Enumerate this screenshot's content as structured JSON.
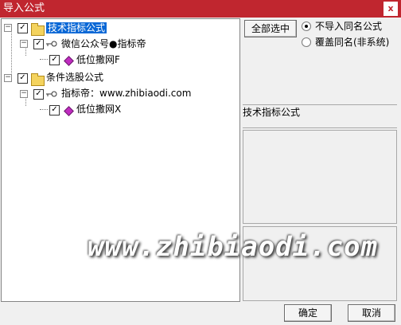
{
  "window": {
    "title": "导入公式",
    "close": "x"
  },
  "tree": {
    "group1": {
      "label": "技术指标公式",
      "checked": true,
      "child": {
        "label": "微信公众号●指标帝",
        "checked": true,
        "leaf": {
          "label": "低位撒网F",
          "checked": true
        }
      }
    },
    "group2": {
      "label": "条件选股公式",
      "checked": true,
      "child": {
        "label": "指标帝：www.zhibiaodi.com",
        "checked": true,
        "leaf": {
          "label": "低位撒网X",
          "checked": true
        }
      }
    }
  },
  "controls": {
    "select_all": "全部选中",
    "radio_no_import": "不导入同名公式",
    "radio_overwrite": "覆盖同名(非系统)",
    "selected_option": "no_import"
  },
  "info": {
    "formula_type": "技术指标公式"
  },
  "footer": {
    "ok": "确定",
    "cancel": "取消"
  },
  "watermark": "www.zhibiaodi.com",
  "icons": [
    "folder-icon",
    "key-icon",
    "diamond-icon",
    "checkbox-icon",
    "expander-icon"
  ],
  "colors": {
    "titlebar": "#c0262f",
    "selection": "#0a68d6",
    "diamond": "#c02bc0"
  }
}
